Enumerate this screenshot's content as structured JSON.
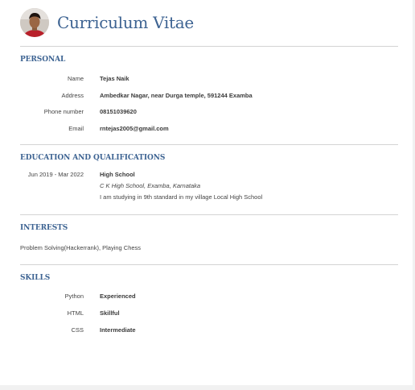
{
  "header": {
    "title": "Curriculum Vitae",
    "avatar_icon": "user-photo"
  },
  "personal": {
    "title": "PERSONAL",
    "rows": [
      {
        "label": "Name",
        "value": "Tejas Naik"
      },
      {
        "label": "Address",
        "value": "Ambedkar Nagar, near Durga temple, 591244 Examba"
      },
      {
        "label": "Phone number",
        "value": "08151039620"
      },
      {
        "label": "Email",
        "value": "rntejas2005@gmail.com"
      }
    ]
  },
  "education": {
    "title": "EDUCATION AND QUALIFICATIONS",
    "entries": [
      {
        "dates": "Jun 2019 - Mar 2022",
        "degree": "High School",
        "institution": "C K High School, Examba, Karnataka",
        "description": "I am studying in 9th standard in my village Local High School"
      }
    ]
  },
  "interests": {
    "title": "INTERESTS",
    "text": "Problem Solving(Hackerrank), Playing Chess"
  },
  "skills": {
    "title": "SKILLS",
    "rows": [
      {
        "label": "Python",
        "value": "Experienced"
      },
      {
        "label": "HTML",
        "value": "Skillful"
      },
      {
        "label": "CSS",
        "value": "Intermediate"
      }
    ]
  },
  "colors": {
    "accent": "#3d6392",
    "divider": "#d4d4d4"
  }
}
